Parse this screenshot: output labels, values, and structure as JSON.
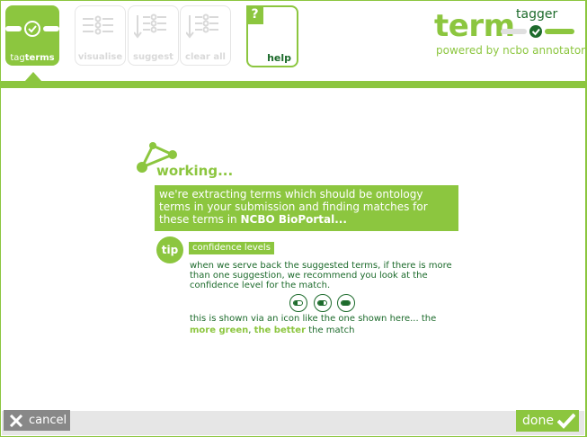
{
  "toolbar": {
    "tools": [
      {
        "label_prefix": "tag",
        "label_bold": "terms",
        "icon": "check-circle-icon",
        "state": "active"
      },
      {
        "label": "visualise",
        "icon": "list-icon",
        "state": "disabled"
      },
      {
        "label": "suggest",
        "icon": "suggest-list-icon",
        "state": "disabled"
      },
      {
        "label": "clear all",
        "icon": "clear-list-icon",
        "state": "disabled"
      }
    ],
    "help": {
      "badge": "?",
      "label": "help"
    }
  },
  "logo": {
    "term": "term",
    "tagger": "tagger",
    "powered": "powered by ncbo annotator"
  },
  "working": {
    "title": "working...",
    "message_lines": [
      "we're extracting terms which should be ontology",
      "terms in your submission and finding matches for"
    ],
    "message_tail_prefix": "these terms in ",
    "message_tail_bold": "NCBO BioPortal..."
  },
  "tip": {
    "badge": "tip",
    "title": "confidence levels",
    "text1": "when we serve back the suggested terms, if there is more than one suggestion, we recommend you look at the confidence level for the match.",
    "icons": [
      {
        "name": "low",
        "level": 0.4
      },
      {
        "name": "medium",
        "level": 0.7
      },
      {
        "name": "high",
        "level": 1.0
      }
    ],
    "text2_prefix": "this is shown via an icon like the one shown here... the",
    "text2_hl1": "more green",
    "text2_sep": ", ",
    "text2_hl2": "the better",
    "text2_suffix": " the match"
  },
  "footer": {
    "cancel_label": "cancel",
    "done_label": "done"
  },
  "colors": {
    "accent": "#8cc63f",
    "dark": "#1d6b2c",
    "disabled": "#d9d9d9",
    "cancel_bg": "#888888"
  }
}
